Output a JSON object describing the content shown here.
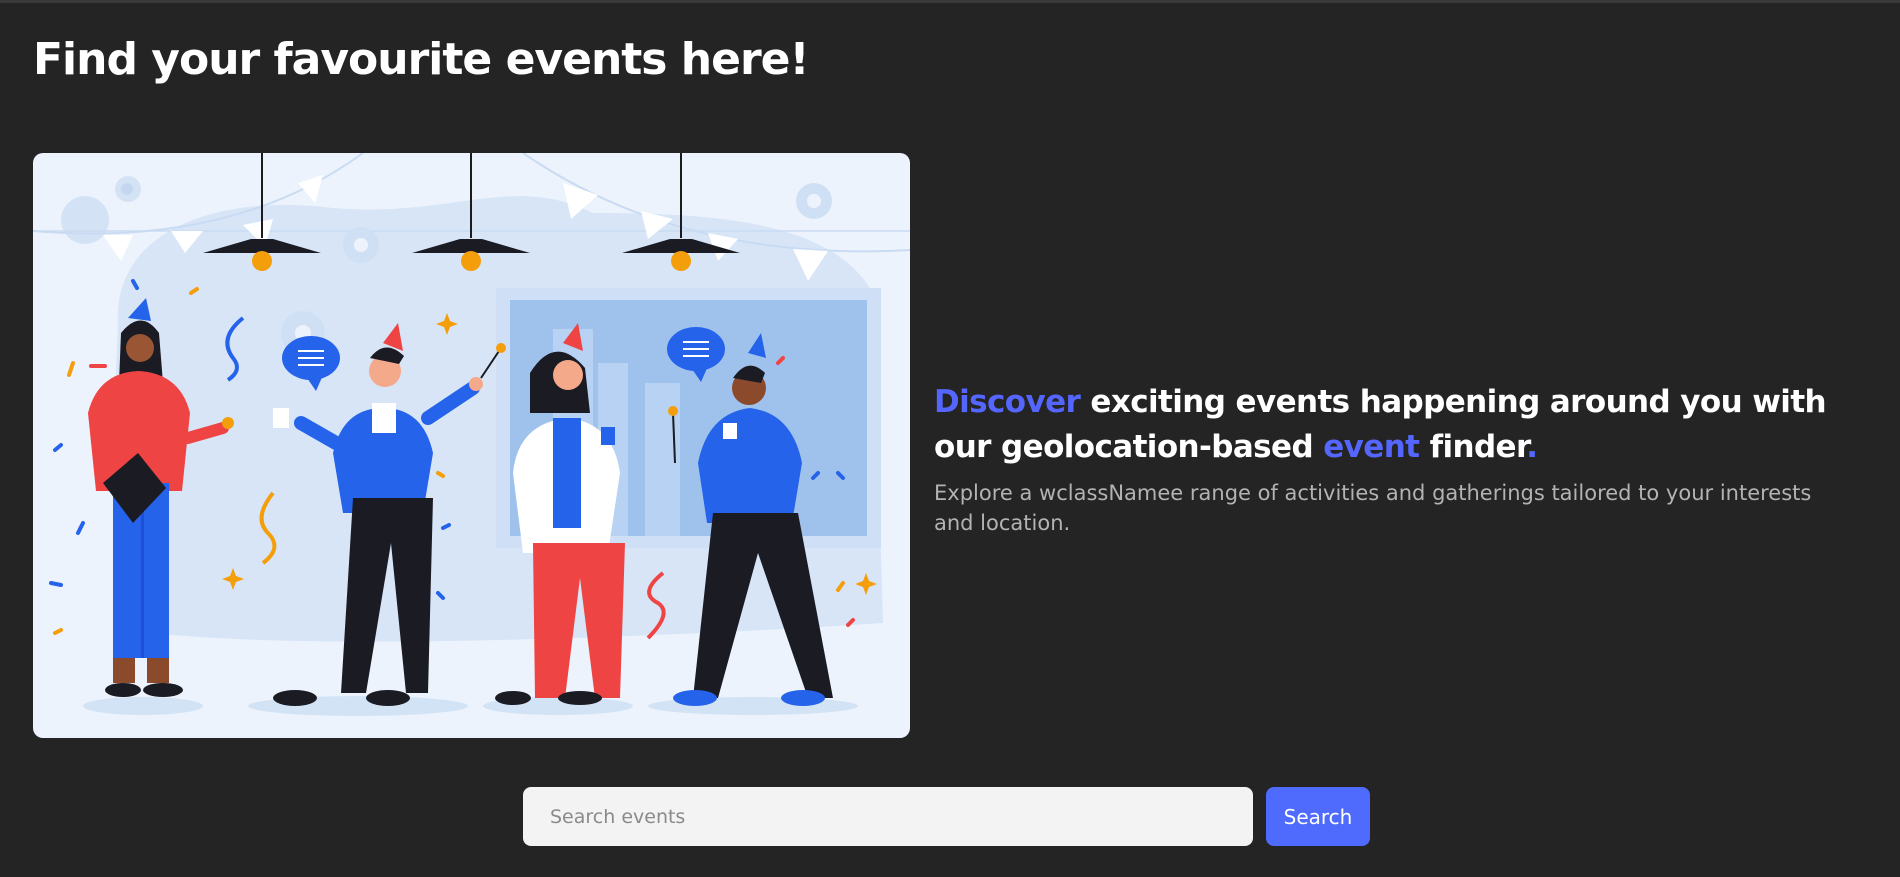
{
  "page": {
    "title": "Find your favourite events here!"
  },
  "hero": {
    "image_alt": "Illustration of four people celebrating at a party with party hats and sparklers",
    "headline": {
      "word1": "Discover",
      "part2": " exciting events happening around you with our geolocation-based ",
      "word3": "event",
      "part4": " finder",
      "dot": "."
    },
    "subtext": "Explore a wclassNamee range of activities and gatherings tailored to your interests and location."
  },
  "search": {
    "placeholder": "Search events",
    "value": "",
    "button_label": "Search"
  },
  "colors": {
    "background": "#242424",
    "accent": "#5566ff",
    "button": "#4f6bfe",
    "card": "#edf3fc"
  }
}
